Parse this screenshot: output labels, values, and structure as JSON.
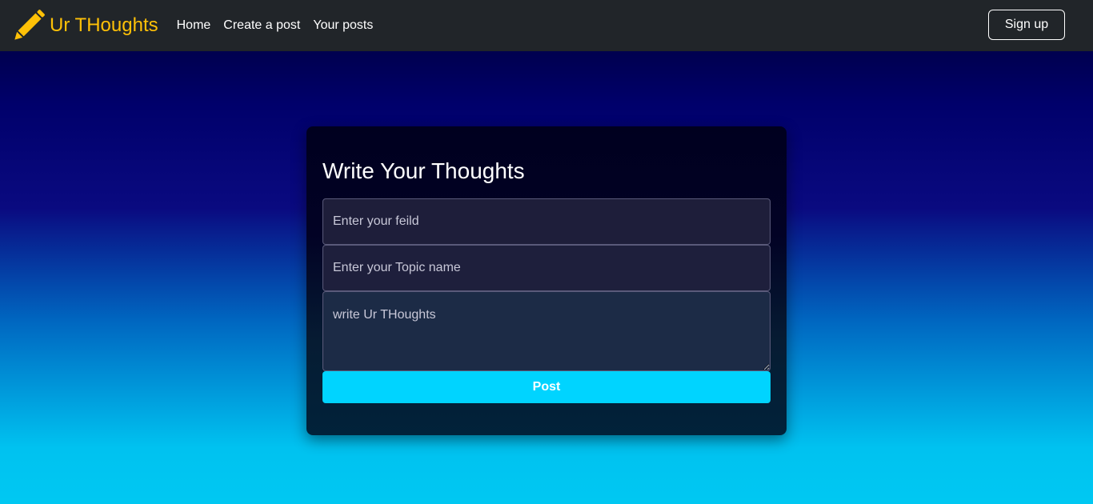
{
  "navbar": {
    "brand_text": "Ur THoughts",
    "brand_icon": "pencil-icon",
    "links": [
      "Home",
      "Create a post",
      "Your posts"
    ],
    "signup_label": "Sign up"
  },
  "form": {
    "title": "Write Your Thoughts",
    "field_placeholder": "Enter your feild",
    "topic_placeholder": "Enter your Topic name",
    "thoughts_placeholder": "write Ur THoughts",
    "post_label": "Post"
  },
  "colors": {
    "navbar_bg": "#212529",
    "brand": "#ffc107",
    "accent_button": "#00d4ff"
  }
}
